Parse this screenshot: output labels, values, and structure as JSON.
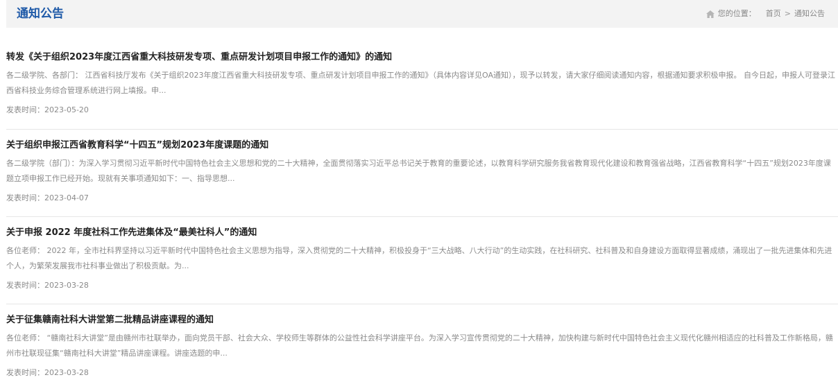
{
  "header": {
    "title": "通知公告",
    "breadcrumb": {
      "prefix": "您的位置：",
      "home": "首页",
      "separator": ">",
      "current": "通知公告"
    },
    "home_icon": "home-icon"
  },
  "notices": [
    {
      "title": "转发《关于组织2023年度江西省重大科技研发专项、重点研发计划项目申报工作的通知》的通知",
      "summary": "各二级学院、各部门：          江西省科技厅发布《关于组织2023年度江西省重大科技研发专项、重点研发计划项目申报工作的通知》（具体内容详见OA通知），现予以转发，请大家仔细阅读通知内容，根据通知要求积极申报。      自今日起，申报人可登录江西省科技业务综合管理系统进行网上填报。申...",
      "date": "发表时间：2023-05-20"
    },
    {
      "title": "关于组织申报江西省教育科学“十四五”规划2023年度课题的通知",
      "summary": "各二级学院（部门）：为深入学习贯彻习近平新时代中国特色社会主义思想和党的二十大精神，全面贯彻落实习近平总书记关于教育的重要论述，以教育科学研究服务我省教育现代化建设和教育强省战略，江西省教育科学“十四五”规划2023年度课题立项申报工作已经开始。现就有关事项通知如下：一、指导思想...",
      "date": "发表时间：2023-04-07"
    },
    {
      "title": "关于申报 2022 年度社科工作先进集体及“最美社科人”的通知",
      "summary": "各位老师：          2022 年，全市社科界坚持以习近平新时代中国特色社会主义思想为指导，深入贯彻党的二十大精神，积极投身于“三大战略、八大行动”的生动实践，在社科研究、社科普及和自身建设方面取得显著成绩，涌现出了一批先进集体和先进个人，为繁荣发展我市社科事业做出了积极贡献。为...",
      "date": "发表时间：2023-03-28"
    },
    {
      "title": "关于征集赣南社科大讲堂第二批精品讲座课程的通知",
      "summary": "各位老师：          “赣南社科大讲堂”是由赣州市社联举办，面向党员干部、社会大众、学校师生等群体的公益性社会科学讲座平台。为深入学习宣传贯彻党的二十大精神，加快构建与新时代中国特色社会主义现代化赣州相适应的社科普及工作新格局，赣州市社联现征集“赣南社科大讲堂”精品讲座课程。讲座选题的申...",
      "date": "发表时间：2023-03-28"
    }
  ]
}
